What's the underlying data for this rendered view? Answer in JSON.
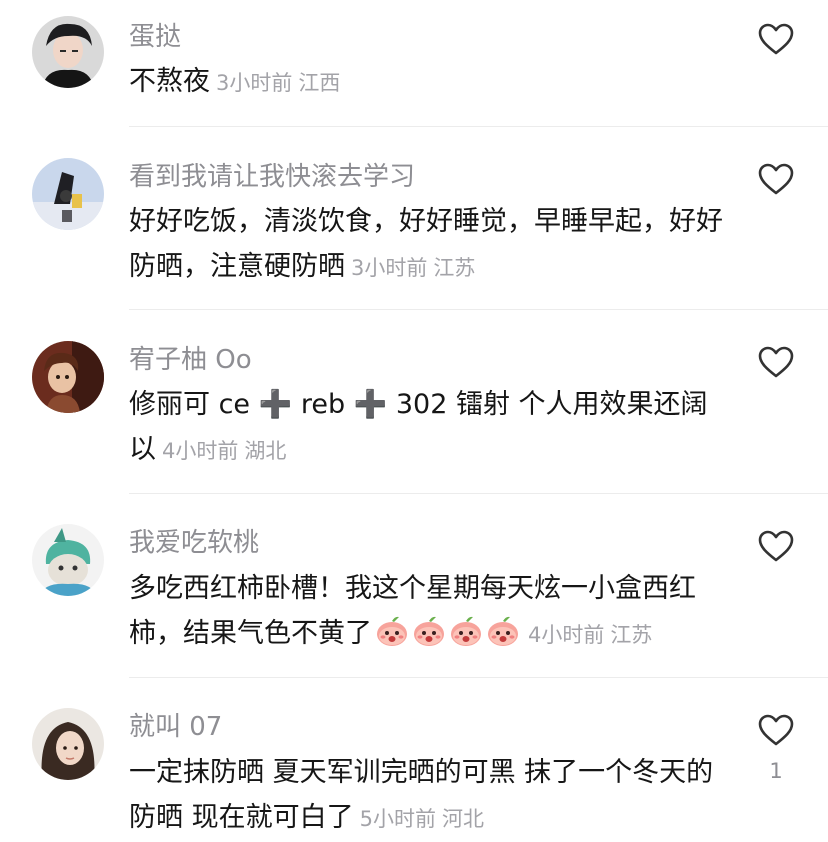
{
  "comments": [
    {
      "username": "蛋挞",
      "text": "不熬夜",
      "time": "3小时前",
      "location": "江西",
      "likes": ""
    },
    {
      "username": "看到我请让我快滚去学习",
      "text": "好好吃饭，清淡饮食，好好睡觉，早睡早起，好好防晒，注意硬防晒",
      "time": "3小时前",
      "location": "江苏",
      "likes": ""
    },
    {
      "username": "宥子柚 Oo",
      "text": "修丽可 ce ➕ reb  ➕ 302 镭射 个人用效果还阔以",
      "time": "4小时前",
      "location": "湖北",
      "likes": ""
    },
    {
      "username": "我爱吃软桃",
      "text": "多吃西红柿卧槽！我这个星期每天炫一小盒西红柿，结果气色不黄了",
      "emoji_count": 4,
      "emoji_icon": "peach-face-emoji",
      "time": "4小时前",
      "location": "江苏",
      "likes": ""
    },
    {
      "username": "就叫 07",
      "text": "一定抹防晒 夏天军训完晒的可黑 抹了一个冬天的防晒 现在就可白了",
      "time": "5小时前",
      "location": "河北",
      "likes": "1"
    }
  ],
  "icons": {
    "like": "heart-outline-icon"
  },
  "colors": {
    "username": "#8e8e93",
    "text": "#161616",
    "meta": "#a3a3a8",
    "divider": "#ececec"
  }
}
